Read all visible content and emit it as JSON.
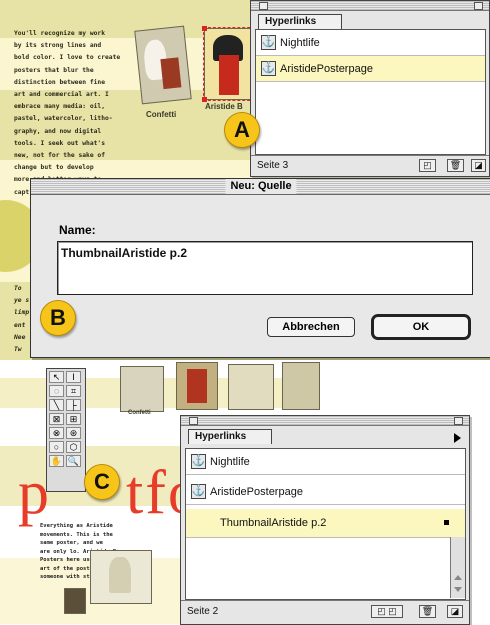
{
  "top_doc": {
    "paragraph": "You'll recognize my work\nby its strong lines and\nbold color. I love to create\nposters that blur the\ndistinction between fine\nart and commercial art. I\nembrace many media: oil,\npastel, watercolor, litho-\ngraphy, and now digital\ntools. I seek out what's\nnew, not for the sake of\nchange but to develop\nmore and better ways to\ncapt",
    "thumb1_caption": "Confetti",
    "thumb2_caption": "Aristide B",
    "side_text": "To\nye s\nlimp\nent\nNee\nTw"
  },
  "panel_top": {
    "tab": "Hyperlinks",
    "items": [
      {
        "label": "Nightlife",
        "selected": false
      },
      {
        "label": "AristidePosterpage",
        "selected": true
      }
    ],
    "footer": "Seite 3"
  },
  "dialog": {
    "title": "Neu: Quelle",
    "name_label": "Name:",
    "name_value": "ThumbnailAristide p.2",
    "cancel": "Abbrechen",
    "ok": "OK"
  },
  "callouts": {
    "a": "A",
    "b": "B",
    "c": "C"
  },
  "bottom_doc": {
    "caption": "Confetti",
    "big_letters_left": "p",
    "big_letters_right": "tfo",
    "small_text": "Everything as Aristide\nmovements. This is the\nsame poster, and we\nare only lo. Aristide Bruan\nPosters here use the\nart of the poster to\nsomeone with strong"
  },
  "panel_bottom": {
    "tab": "Hyperlinks",
    "items": [
      {
        "label": "Nightlife",
        "selected": false
      },
      {
        "label": "AristidePosterpage",
        "selected": false
      },
      {
        "label": "ThumbnailAristide p.2",
        "selected": true
      }
    ],
    "footer": "Seite 2"
  },
  "colors": {
    "callout": "#f7c51a",
    "selection": "#fbf7be",
    "doc_background": "#fbf6cf",
    "accent_red": "#e83c2a"
  }
}
